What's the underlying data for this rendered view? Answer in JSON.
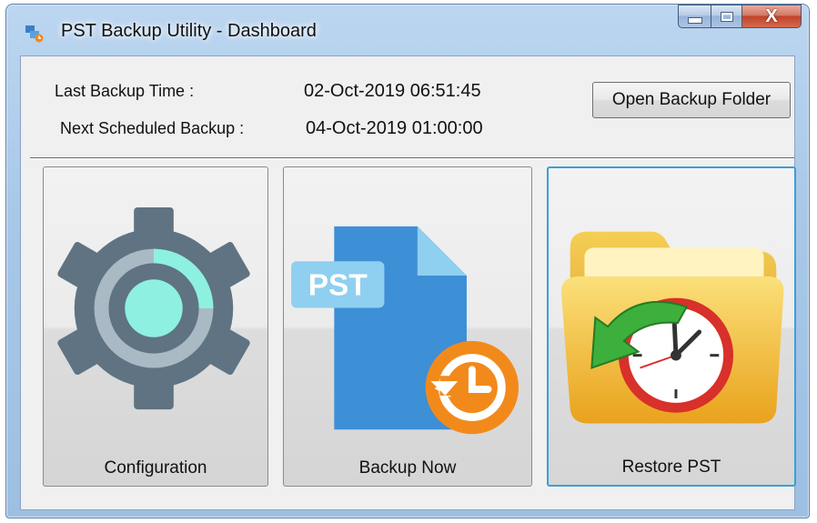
{
  "window": {
    "title": "PST Backup Utility - Dashboard",
    "close_glyph": "X",
    "icons": {
      "app": "pst-backup-app-icon",
      "minimize": "minimize-icon",
      "maximize": "maximize-icon",
      "close": "close-icon"
    }
  },
  "info": {
    "last_backup_label": "Last Backup Time :",
    "last_backup_value": "02-Oct-2019 06:51:45",
    "next_backup_label": "Next Scheduled Backup :",
    "next_backup_value": "04-Oct-2019 01:00:00"
  },
  "toolbar": {
    "open_folder_label": "Open Backup Folder"
  },
  "tiles": [
    {
      "label": "Configuration",
      "icon": "gear-icon"
    },
    {
      "label": "Backup Now",
      "icon": "pst-file-backup-icon",
      "icon_text": "PST"
    },
    {
      "label": "Restore PST",
      "icon": "folder-clock-restore-icon"
    }
  ],
  "colors": {
    "gear": "#5f7382",
    "gear_ring": "#a9bac4",
    "gear_center": "#8ef0e0",
    "pst_doc": "#3d8fd6",
    "pst_badge": "#8fcff0",
    "backup_clock": "#f28a1b",
    "folder": "#f7c842",
    "restore_arrow": "#3caf3c",
    "clock_rim": "#d8302a",
    "active_border": "#3c9fd8"
  }
}
